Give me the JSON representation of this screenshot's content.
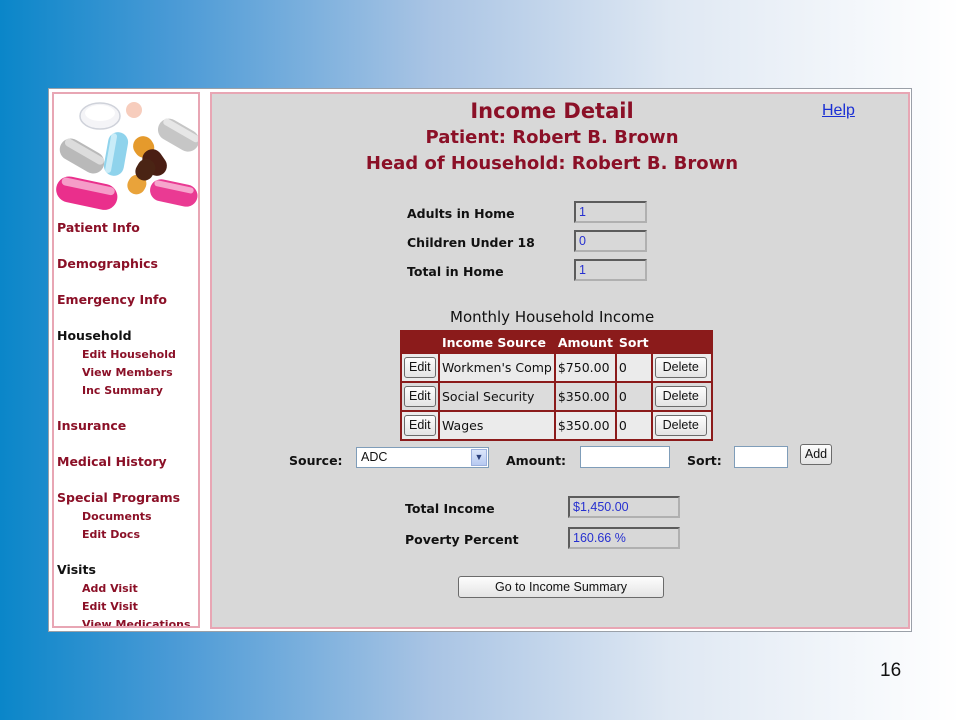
{
  "sidebar": {
    "patient_info": "Patient Info",
    "demographics": "Demographics",
    "emergency_info": "Emergency Info",
    "household": "Household",
    "edit_household": "Edit Household",
    "view_members": "View Members",
    "inc_summary": "Inc Summary",
    "insurance": "Insurance",
    "medical_history": "Medical History",
    "special_programs": "Special Programs",
    "documents": "Documents",
    "edit_docs": "Edit Docs",
    "visits": "Visits",
    "add_visit": "Add Visit",
    "edit_visit": "Edit Visit",
    "view_medications": "View Medications"
  },
  "header": {
    "title": "Income Detail",
    "patient": "Patient: Robert B. Brown",
    "head_of_household": "Head of Household: Robert B. Brown",
    "help": "Help"
  },
  "household": {
    "adults_label": "Adults in Home",
    "adults_value": "1",
    "children_label": "Children Under 18",
    "children_value": "0",
    "total_label": "Total in Home",
    "total_value": "1"
  },
  "income_table": {
    "heading": "Monthly Household Income",
    "columns": [
      "",
      "Income Source",
      "Amount",
      "Sort",
      ""
    ],
    "edit_label": "Edit",
    "delete_label": "Delete",
    "rows": [
      {
        "source": "Workmen's Comp",
        "amount": "$750.00",
        "sort": "0"
      },
      {
        "source": "Social Security",
        "amount": "$350.00",
        "sort": "0"
      },
      {
        "source": "Wages",
        "amount": "$350.00",
        "sort": "0"
      }
    ]
  },
  "add_form": {
    "source_label": "Source:",
    "source_value": "ADC",
    "amount_label": "Amount:",
    "amount_value": "",
    "sort_label": "Sort:",
    "sort_value": "",
    "add_button": "Add"
  },
  "totals": {
    "total_income_label": "Total Income",
    "total_income_value": "$1,450.00",
    "poverty_label": "Poverty Percent",
    "poverty_value": "160.66 %"
  },
  "summary_button": "Go to Income Summary",
  "slide_number": "16",
  "colors": {
    "accent": "#8b1027",
    "table_header": "#8b1b1b",
    "link": "#1a2fd4",
    "value_text": "#2630d0"
  }
}
